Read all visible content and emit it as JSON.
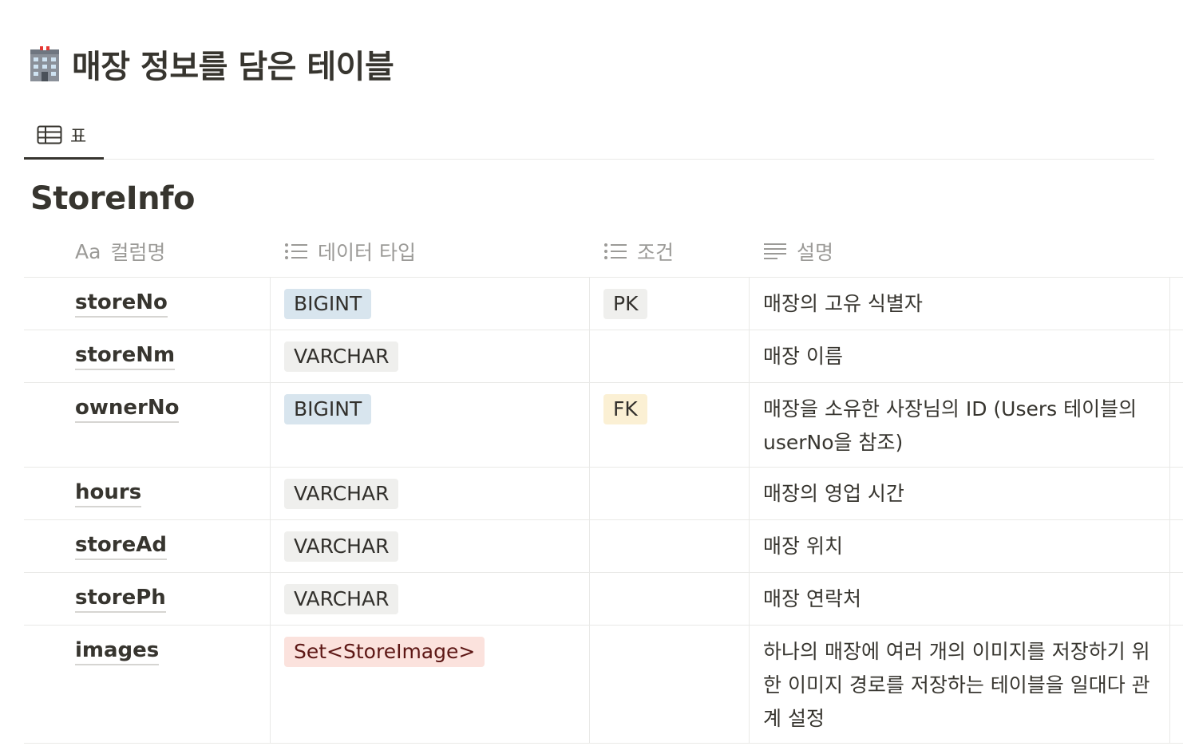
{
  "page": {
    "title": "매장 정보를 담은 테이블",
    "icon": "office-building-icon"
  },
  "view_tab": {
    "label": "표",
    "icon": "table-icon"
  },
  "database": {
    "title": "StoreInfo"
  },
  "columns": [
    {
      "prefix": "Aa",
      "label": "컬럼명",
      "icon": "title-property-icon"
    },
    {
      "label": "데이터 타입",
      "icon": "multi-select-icon"
    },
    {
      "label": "조건",
      "icon": "multi-select-icon"
    },
    {
      "label": "설명",
      "icon": "text-property-icon"
    }
  ],
  "rows": [
    {
      "name": "storeNo",
      "type": "BIGINT",
      "type_color": "blue",
      "condition": "PK",
      "condition_color": "gray",
      "desc": "매장의 고유 식별자"
    },
    {
      "name": "storeNm",
      "type": "VARCHAR",
      "type_color": "gray",
      "condition": "",
      "condition_color": "",
      "desc": "매장 이름"
    },
    {
      "name": "ownerNo",
      "type": "BIGINT",
      "type_color": "blue",
      "condition": "FK",
      "condition_color": "yellow",
      "desc": "매장을 소유한 사장님의 ID (Users 테이블의 userNo을 참조)"
    },
    {
      "name": "hours",
      "type": "VARCHAR",
      "type_color": "gray",
      "condition": "",
      "condition_color": "",
      "desc": "매장의 영업 시간"
    },
    {
      "name": "storeAd",
      "type": "VARCHAR",
      "type_color": "gray",
      "condition": "",
      "condition_color": "",
      "desc": "매장 위치"
    },
    {
      "name": "storePh",
      "type": "VARCHAR",
      "type_color": "gray",
      "condition": "",
      "condition_color": "",
      "desc": "매장 연락처"
    },
    {
      "name": "images",
      "type": "Set<StoreImage>",
      "type_color": "red",
      "condition": "",
      "condition_color": "",
      "desc": "하나의 매장에 여러 개의 이미지를 저장하기 위한 이미지 경로를 저장하는 테이블을 일대다 관계 설정"
    }
  ],
  "colors": {
    "text": "#37352f",
    "muted": "#9b9a97",
    "border": "#e9e9e7",
    "tag_gray": "#efefed",
    "tag_blue": "#d8e5ee",
    "tag_yellow": "#fbf0d4",
    "tag_red": "#fbe2dd"
  }
}
